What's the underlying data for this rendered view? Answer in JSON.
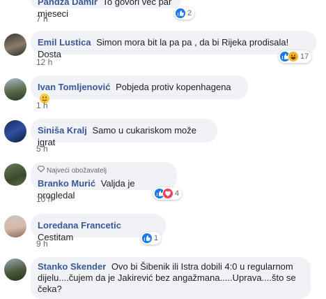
{
  "comments": [
    {
      "author": "Pandža Damir",
      "text": "To govori već par mjeseci",
      "time": "7 h",
      "reaction_count": "2",
      "reactions": [
        "like-icon"
      ]
    },
    {
      "author": "Emil Lustica",
      "text": "Simon mora bit la pa pa , da bi Rijeka prodisala! Dosta",
      "time": "12 h",
      "reaction_count": "17",
      "reactions": [
        "like-icon",
        "haha-icon"
      ]
    },
    {
      "author": "Ivan Tomljenović",
      "text": "Pobjeda protiv kopenhagena",
      "time": "1 h"
    },
    {
      "author": "Siniša Kralj",
      "text": "Samo u cukariskom može igrat",
      "time": "5 h"
    },
    {
      "author": "Branko Murić",
      "badge": "Najveći obožavatelj",
      "text": "Valjda je progledal",
      "time": "10 h",
      "reaction_count": "4",
      "reactions": [
        "like-icon",
        "love-icon"
      ]
    },
    {
      "author": "Loredana Francetic",
      "text": "Cestitam",
      "time": "9 h",
      "reaction_count": "1",
      "reactions": [
        "like-icon"
      ]
    },
    {
      "author": "Stanko Skender",
      "text_line1": "Ovo bi Šibenik ili Istra dobili 4:0 u regularnom",
      "text_line2": "dijelu....čujem da je Jakirević bez angažmana.....Uprava....što se",
      "text_line3": "čeka?"
    }
  ],
  "colors": {
    "author": "#385898",
    "bubble": "#f0f2f5",
    "like": "#1877f2",
    "love": "#f33e58",
    "haha": "#f7b125"
  }
}
